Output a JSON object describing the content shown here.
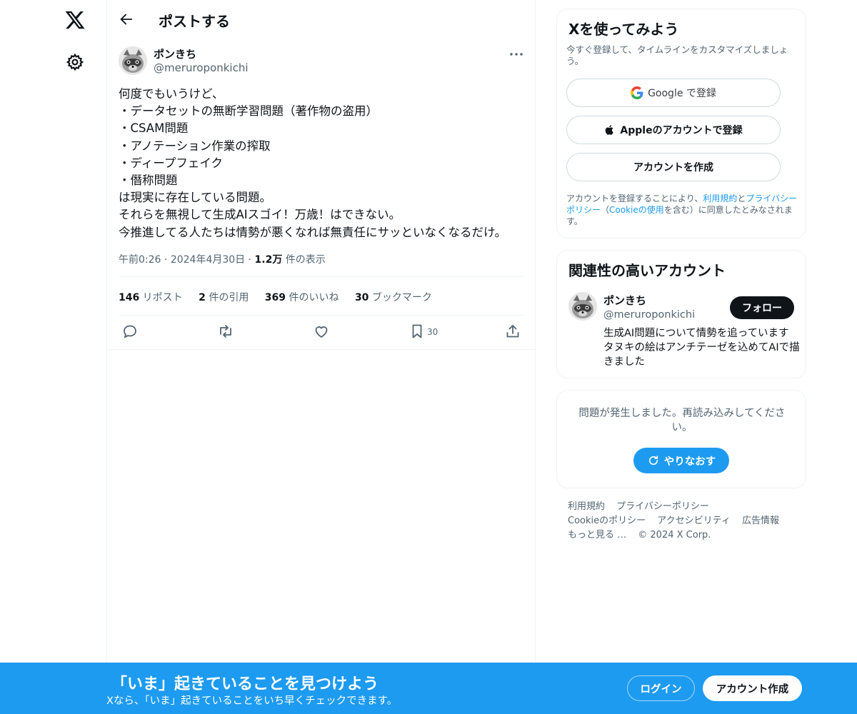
{
  "colors": {
    "accent": "#1d9bf0",
    "text": "#0f1419",
    "secondary": "#536471",
    "border": "#eff3f4"
  },
  "nav": {
    "logo_icon": "x-logo-icon",
    "settings_icon": "gear-icon"
  },
  "header": {
    "title": "ポストする",
    "back_icon": "arrow-left-icon"
  },
  "post": {
    "author_name": "ポンきち",
    "author_handle": "@meruroponkichi",
    "lines": [
      "何度でもいうけど、",
      "・データセットの無断学習問題（著作物の盗用）",
      "・CSAM問題",
      "・アノテーション作業の搾取",
      "・ディープフェイク",
      "・僭称問題",
      "は現実に存在している問題。",
      "それらを無視して生成AIスゴイ！万歳！はできない。",
      "今推進してる人たちは情勢が悪くなれば無責任にサッといなくなるだけ。"
    ],
    "time": "午前0:26",
    "date": "2024年4月30日",
    "views_count": "1.2万",
    "views_label": " 件の表示",
    "stats": {
      "reposts_count": "146",
      "reposts_label": " リポスト",
      "quotes_count": "2",
      "quotes_label": " 件の引用",
      "likes_count": "369",
      "likes_label": " 件のいいね",
      "bookmarks_count": "30",
      "bookmarks_label": " ブックマーク"
    },
    "actions": {
      "bookmark_count": "30"
    }
  },
  "signup_card": {
    "title": "Xを使ってみよう",
    "subtitle": "今すぐ登録して、タイムラインをカスタマイズしましょう。",
    "google_label": "Google で登録",
    "apple_label": "Appleのアカウントで登録",
    "create_label": "アカウントを作成",
    "terms_pre": "アカウントを登録することにより、",
    "terms_link1": "利用規約",
    "terms_and": "と",
    "terms_link2": "プライバシーポリシー",
    "terms_mid": "（",
    "terms_link3": "Cookieの使用",
    "terms_post": "を含む）に同意したとみなされます。"
  },
  "relevant": {
    "title": "関連性の高いアカウント",
    "name": "ポンきち",
    "handle": "@meruroponkichi",
    "follow_label": "フォロー",
    "bio": "生成AI問題について情勢を追っています タヌキの絵はアンチテーゼを込めてAIで描きました"
  },
  "error_card": {
    "text": "問題が発生しました。再読み込みしてください。",
    "retry_label": "やりなおす"
  },
  "footer": {
    "terms": "利用規約",
    "privacy": "プライバシーポリシー",
    "cookie": "Cookieのポリシー",
    "accessibility": "アクセシビリティ",
    "ads": "広告情報",
    "more": "もっと見る …",
    "copyright": "© 2024 X Corp."
  },
  "bottom_bar": {
    "title": "「いま」起きていることを見つけよう",
    "subtitle": "Xなら、「いま」起きていることをいち早くチェックできます。",
    "login_label": "ログイン",
    "signup_label": "アカウント作成"
  }
}
